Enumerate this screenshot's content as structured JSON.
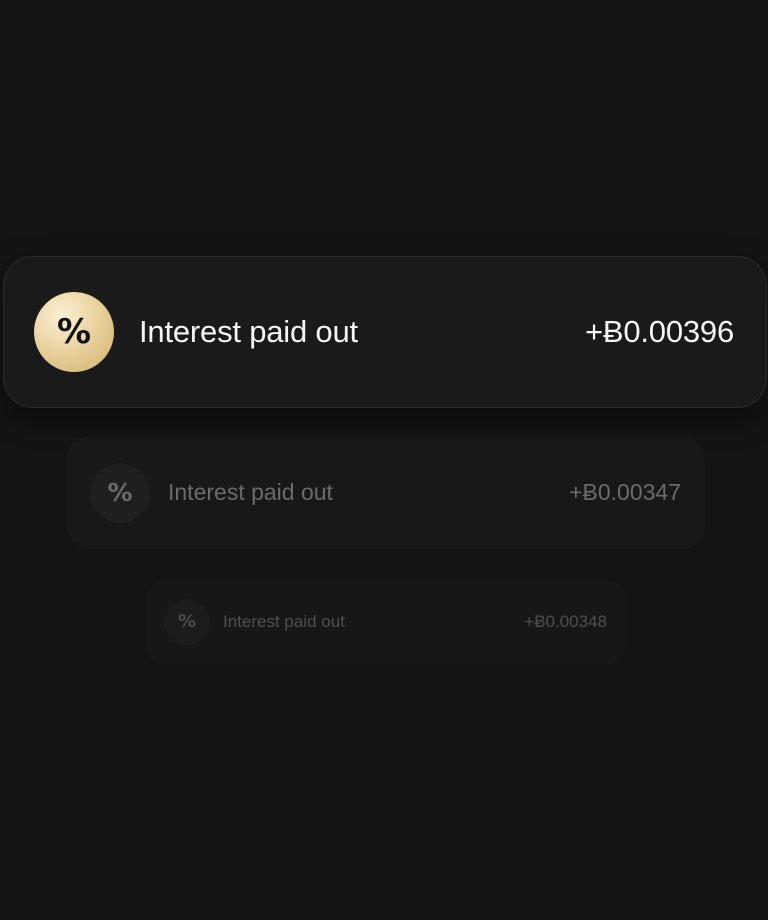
{
  "notifications": [
    {
      "icon": "percent-icon",
      "icon_glyph": "%",
      "label": "Interest paid out",
      "amount": "+Ƀ0.00396"
    },
    {
      "icon": "percent-icon",
      "icon_glyph": "%",
      "label": "Interest paid out",
      "amount": "+Ƀ0.00347"
    },
    {
      "icon": "percent-icon",
      "icon_glyph": "%",
      "label": "Interest paid out",
      "amount": "+Ƀ0.00348"
    }
  ],
  "colors": {
    "background": "#141414",
    "gold_accent": "#e6cc95",
    "primary_text": "#f5f5f5",
    "muted_text": "#6b6b6b"
  }
}
